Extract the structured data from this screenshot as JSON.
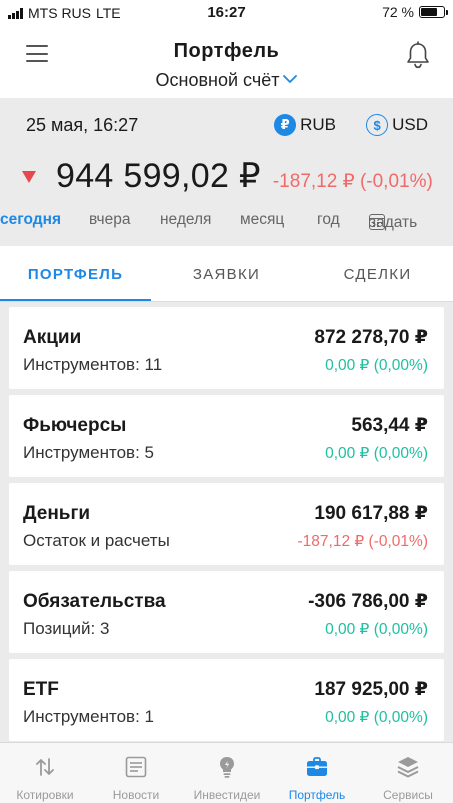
{
  "status_bar": {
    "carrier": "MTS RUS",
    "network": "LTE",
    "time": "16:27",
    "battery": "72 %",
    "battery_level": 0.72
  },
  "header": {
    "title": "Портфель",
    "account": "Основной счёт"
  },
  "summary": {
    "date": "25 мая, 16:27",
    "currencies": [
      {
        "code": "RUB",
        "symbol": "₽",
        "selected": true
      },
      {
        "code": "USD",
        "symbol": "$",
        "selected": false
      }
    ],
    "total": "944 599,02 ₽",
    "change": "-187,12 ₽ (-0,01%)",
    "trend": "down"
  },
  "periods": [
    {
      "label": "сегодня",
      "active": true
    },
    {
      "label": "вчера",
      "active": false
    },
    {
      "label": "неделя",
      "active": false
    },
    {
      "label": "месяц",
      "active": false
    },
    {
      "label": "год",
      "active": false
    },
    {
      "label": "задать",
      "active": false
    }
  ],
  "tabs": [
    {
      "label": "ПОРТФЕЛЬ",
      "active": true
    },
    {
      "label": "ЗАЯВКИ",
      "active": false
    },
    {
      "label": "СДЕЛКИ",
      "active": false
    }
  ],
  "cards": [
    {
      "name": "Акции",
      "sub": "Инструментов: 11",
      "value": "872 278,70 ₽",
      "change": "0,00 ₽ (0,00%)",
      "trend": "pos"
    },
    {
      "name": "Фьючерсы",
      "sub": "Инструментов: 5",
      "value": "563,44 ₽",
      "change": "0,00 ₽ (0,00%)",
      "trend": "pos"
    },
    {
      "name": "Деньги",
      "sub": "Остаток и расчеты",
      "value": "190 617,88 ₽",
      "change": "-187,12 ₽ (-0,01%)",
      "trend": "neg"
    },
    {
      "name": "Обязательства",
      "sub": "Позиций: 3",
      "value": "-306 786,00 ₽",
      "change": "0,00 ₽ (0,00%)",
      "trend": "pos"
    },
    {
      "name": "ETF",
      "sub": "Инструментов: 1",
      "value": "187 925,00 ₽",
      "change": "0,00 ₽ (0,00%)",
      "trend": "pos"
    }
  ],
  "bottom_nav": [
    {
      "label": "Котировки",
      "icon": "arrows-updown-icon",
      "active": false
    },
    {
      "label": "Новости",
      "icon": "newspaper-icon",
      "active": false
    },
    {
      "label": "Инвестидеи",
      "icon": "lightbulb-icon",
      "active": false
    },
    {
      "label": "Портфель",
      "icon": "briefcase-icon",
      "active": true
    },
    {
      "label": "Сервисы",
      "icon": "layers-icon",
      "active": false
    }
  ],
  "colors": {
    "accent": "#1e88e5",
    "negative": "#ef6a6a",
    "positive": "#1fbfa0",
    "background": "#ebebeb"
  }
}
